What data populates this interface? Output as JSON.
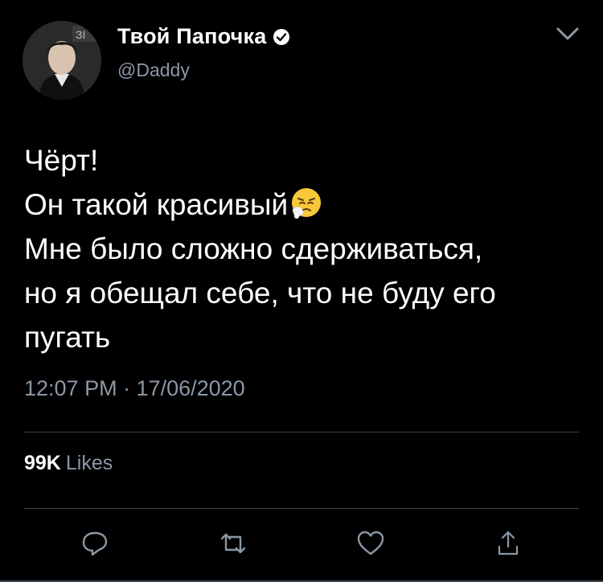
{
  "author": {
    "display_name": "Твой Папочка",
    "handle": "@Daddy",
    "verified": true
  },
  "icons": {
    "verified": "verified-badge-icon",
    "more": "chevron-down-icon",
    "reply": "reply-icon",
    "retweet": "retweet-icon",
    "like": "heart-icon",
    "share": "share-icon",
    "emoji": "sneezing-face-emoji"
  },
  "tweet": {
    "lines": [
      "Чёрт!",
      "Он такой красивый",
      "Мне было сложно сдерживаться,",
      "но я обещал себе, что не буду его",
      "пугать"
    ],
    "timestamp": "12:07 PM · 17/06/2020"
  },
  "stats": {
    "likes_count": "99K",
    "likes_label": "Likes"
  },
  "colors": {
    "background": "#000000",
    "text": "#ffffff",
    "secondary": "#8b98a5",
    "divider": "#38444d"
  }
}
